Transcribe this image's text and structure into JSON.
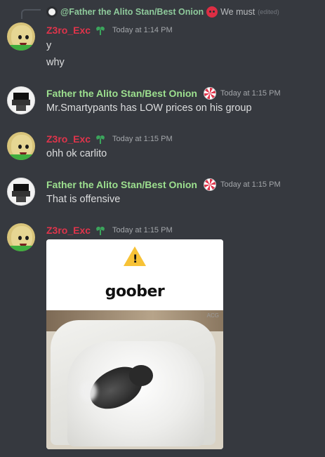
{
  "reply": {
    "author": "@Father the Alito Stan/Best Onion",
    "text": "We must",
    "edited": "(edited)",
    "icon": "angry-face-icon"
  },
  "messages": [
    {
      "author": "Z3ro_Exc",
      "badge": "seedling-icon",
      "timestamp": "Today at 1:14 PM",
      "lines": [
        "y",
        "why"
      ]
    },
    {
      "author": "Father the Alito Stan/Best Onion",
      "badge": "peppermint-candy-icon",
      "timestamp": "Today at 1:15 PM",
      "lines": [
        "Mr.Smartypants has LOW prices on his group"
      ]
    },
    {
      "author": "Z3ro_Exc",
      "badge": "seedling-icon",
      "timestamp": "Today at 1:15 PM",
      "lines": [
        "ohh ok carlito"
      ]
    },
    {
      "author": "Father the Alito Stan/Best Onion",
      "badge": "peppermint-candy-icon",
      "timestamp": "Today at 1:15 PM",
      "lines": [
        "That is offensive"
      ]
    },
    {
      "author": "Z3ro_Exc",
      "badge": "seedling-icon",
      "timestamp": "Today at 1:15 PM",
      "lines": []
    }
  ],
  "gif": {
    "icon": "warning-icon",
    "warning_glyph": "!",
    "caption": "goober",
    "watermark": "ACG"
  },
  "colors": {
    "background": "#36393f",
    "z3ro_name": "#e0344b",
    "father_name": "#9de08f",
    "text": "#dcddde",
    "timestamp": "#a3a6aa"
  }
}
